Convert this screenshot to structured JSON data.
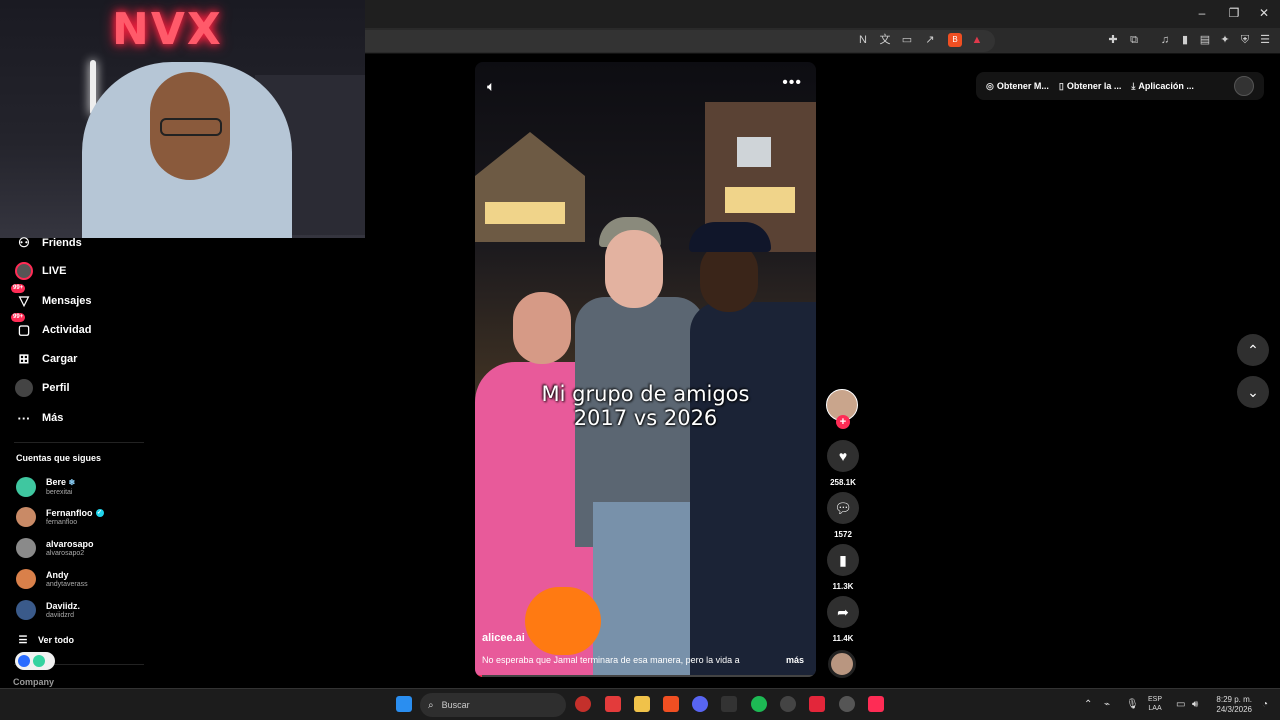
{
  "webcam": {
    "neon_sign": "NVX"
  },
  "sidebar": {
    "items": [
      {
        "label": "Friends",
        "icon": "friends-icon"
      },
      {
        "label": "LIVE",
        "icon": "live-icon"
      },
      {
        "label": "Mensajes",
        "icon": "messages-icon",
        "badge": "99+"
      },
      {
        "label": "Actividad",
        "icon": "activity-icon",
        "badge": "99+"
      },
      {
        "label": "Cargar",
        "icon": "upload-icon"
      },
      {
        "label": "Perfil",
        "icon": "profile-icon"
      },
      {
        "label": "Más",
        "icon": "more-icon"
      }
    ],
    "following_title": "Cuentas que sigues",
    "following": [
      {
        "name": "Bere",
        "user": "berexitai",
        "color": "#3fc7a0"
      },
      {
        "name": "Fernanfloo",
        "user": "fernanfloo",
        "color": "#c98a66"
      },
      {
        "name": "alvarosapo",
        "user": "alvarosapo2",
        "color": "#8a8a8a"
      },
      {
        "name": "Andy",
        "user": "andytaverass",
        "color": "#d9804a"
      },
      {
        "name": "Daviidz.",
        "user": "daviidzrd",
        "color": "#3a5a8a"
      }
    ],
    "see_all": "Ver todo",
    "company": "Company"
  },
  "video": {
    "caption_line1": "Mi grupo de amigos",
    "caption_line2": "2017 vs 2026",
    "author": "alicee.ai",
    "description": "No esperaba que Jamal terminara de esa manera, pero la vida a",
    "more": "más",
    "progress": 0.02
  },
  "actions": {
    "likes": "258.1K",
    "comments": "1572",
    "saves": "11.3K",
    "shares": "11.4K"
  },
  "top_links": [
    {
      "label": "Obtener M...",
      "icon": "coin-icon"
    },
    {
      "label": "Obtener la ...",
      "icon": "phone-icon"
    },
    {
      "label": "Aplicación ...",
      "icon": "download-icon"
    }
  ],
  "taskbar": {
    "search_placeholder": "Buscar",
    "lang_line1": "ESP",
    "lang_line2": "LAA",
    "time": "8:29 p. m.",
    "date": "24/3/2026"
  },
  "colors": {
    "accent": "#fe2c55",
    "background": "#000000",
    "panel": "#2f2f2f"
  }
}
